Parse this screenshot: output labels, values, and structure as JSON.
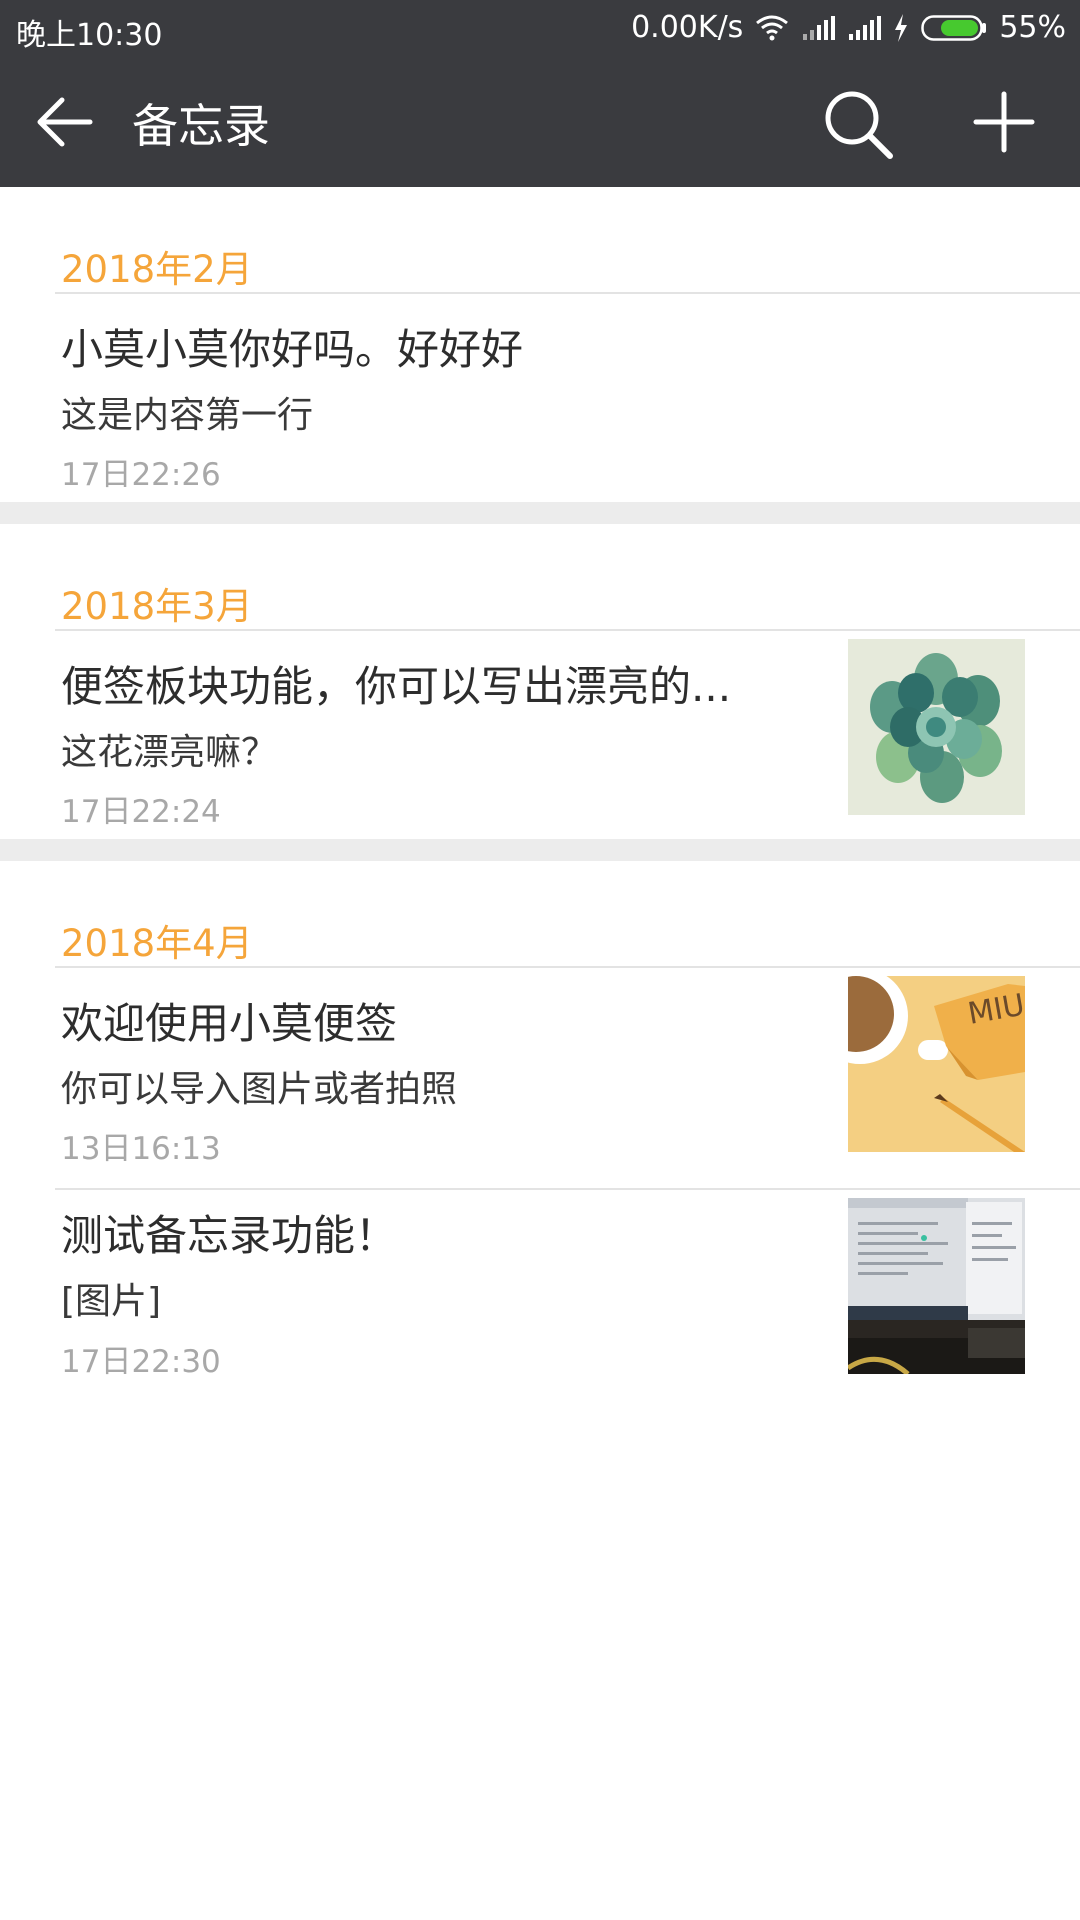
{
  "status_bar": {
    "time": "晚上10:30",
    "network_speed": "0.00K/s",
    "battery": "55%",
    "icons": [
      "wifi-icon",
      "signal-icon",
      "signal-icon",
      "charging-icon",
      "battery-icon"
    ]
  },
  "app_bar": {
    "title": "备忘录",
    "icons": [
      "back-arrow-icon",
      "search-icon",
      "add-icon"
    ]
  },
  "accent_color": "#f5a53a",
  "sections": [
    {
      "month": "2018年2月",
      "notes": [
        {
          "title": "小莫小莫你好吗。好好好",
          "preview": "这是内容第一行",
          "time": "17日22:26",
          "thumbnail": null
        }
      ]
    },
    {
      "month": "2018年3月",
      "notes": [
        {
          "title": "便签板块功能，你可以写出漂亮的...",
          "preview": "这花漂亮嘛？",
          "time": "17日22:24",
          "thumbnail": "succulent-image"
        }
      ]
    },
    {
      "month": "2018年4月",
      "notes": [
        {
          "title": "欢迎使用小莫便签",
          "preview": "你可以导入图片或者拍照",
          "time": "13日16:13",
          "thumbnail": "coffee-notes-image"
        },
        {
          "title": "测试备忘录功能！",
          "preview": "[图片]",
          "time": "17日22:30",
          "thumbnail": "monitor-photo-image"
        }
      ]
    }
  ],
  "thumbnail_text": "MIUI"
}
